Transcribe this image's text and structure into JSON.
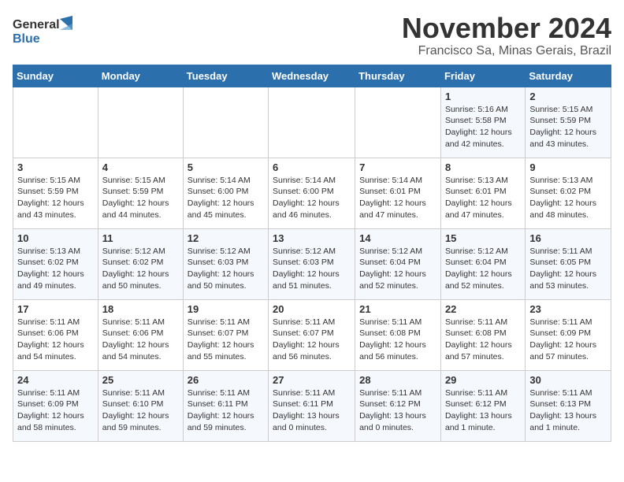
{
  "header": {
    "logo_line1": "General",
    "logo_line2": "Blue",
    "month": "November 2024",
    "location": "Francisco Sa, Minas Gerais, Brazil"
  },
  "weekdays": [
    "Sunday",
    "Monday",
    "Tuesday",
    "Wednesday",
    "Thursday",
    "Friday",
    "Saturday"
  ],
  "weeks": [
    [
      {
        "day": "",
        "info": ""
      },
      {
        "day": "",
        "info": ""
      },
      {
        "day": "",
        "info": ""
      },
      {
        "day": "",
        "info": ""
      },
      {
        "day": "",
        "info": ""
      },
      {
        "day": "1",
        "info": "Sunrise: 5:16 AM\nSunset: 5:58 PM\nDaylight: 12 hours and 42 minutes."
      },
      {
        "day": "2",
        "info": "Sunrise: 5:15 AM\nSunset: 5:59 PM\nDaylight: 12 hours and 43 minutes."
      }
    ],
    [
      {
        "day": "3",
        "info": "Sunrise: 5:15 AM\nSunset: 5:59 PM\nDaylight: 12 hours and 43 minutes."
      },
      {
        "day": "4",
        "info": "Sunrise: 5:15 AM\nSunset: 5:59 PM\nDaylight: 12 hours and 44 minutes."
      },
      {
        "day": "5",
        "info": "Sunrise: 5:14 AM\nSunset: 6:00 PM\nDaylight: 12 hours and 45 minutes."
      },
      {
        "day": "6",
        "info": "Sunrise: 5:14 AM\nSunset: 6:00 PM\nDaylight: 12 hours and 46 minutes."
      },
      {
        "day": "7",
        "info": "Sunrise: 5:14 AM\nSunset: 6:01 PM\nDaylight: 12 hours and 47 minutes."
      },
      {
        "day": "8",
        "info": "Sunrise: 5:13 AM\nSunset: 6:01 PM\nDaylight: 12 hours and 47 minutes."
      },
      {
        "day": "9",
        "info": "Sunrise: 5:13 AM\nSunset: 6:02 PM\nDaylight: 12 hours and 48 minutes."
      }
    ],
    [
      {
        "day": "10",
        "info": "Sunrise: 5:13 AM\nSunset: 6:02 PM\nDaylight: 12 hours and 49 minutes."
      },
      {
        "day": "11",
        "info": "Sunrise: 5:12 AM\nSunset: 6:02 PM\nDaylight: 12 hours and 50 minutes."
      },
      {
        "day": "12",
        "info": "Sunrise: 5:12 AM\nSunset: 6:03 PM\nDaylight: 12 hours and 50 minutes."
      },
      {
        "day": "13",
        "info": "Sunrise: 5:12 AM\nSunset: 6:03 PM\nDaylight: 12 hours and 51 minutes."
      },
      {
        "day": "14",
        "info": "Sunrise: 5:12 AM\nSunset: 6:04 PM\nDaylight: 12 hours and 52 minutes."
      },
      {
        "day": "15",
        "info": "Sunrise: 5:12 AM\nSunset: 6:04 PM\nDaylight: 12 hours and 52 minutes."
      },
      {
        "day": "16",
        "info": "Sunrise: 5:11 AM\nSunset: 6:05 PM\nDaylight: 12 hours and 53 minutes."
      }
    ],
    [
      {
        "day": "17",
        "info": "Sunrise: 5:11 AM\nSunset: 6:06 PM\nDaylight: 12 hours and 54 minutes."
      },
      {
        "day": "18",
        "info": "Sunrise: 5:11 AM\nSunset: 6:06 PM\nDaylight: 12 hours and 54 minutes."
      },
      {
        "day": "19",
        "info": "Sunrise: 5:11 AM\nSunset: 6:07 PM\nDaylight: 12 hours and 55 minutes."
      },
      {
        "day": "20",
        "info": "Sunrise: 5:11 AM\nSunset: 6:07 PM\nDaylight: 12 hours and 56 minutes."
      },
      {
        "day": "21",
        "info": "Sunrise: 5:11 AM\nSunset: 6:08 PM\nDaylight: 12 hours and 56 minutes."
      },
      {
        "day": "22",
        "info": "Sunrise: 5:11 AM\nSunset: 6:08 PM\nDaylight: 12 hours and 57 minutes."
      },
      {
        "day": "23",
        "info": "Sunrise: 5:11 AM\nSunset: 6:09 PM\nDaylight: 12 hours and 57 minutes."
      }
    ],
    [
      {
        "day": "24",
        "info": "Sunrise: 5:11 AM\nSunset: 6:09 PM\nDaylight: 12 hours and 58 minutes."
      },
      {
        "day": "25",
        "info": "Sunrise: 5:11 AM\nSunset: 6:10 PM\nDaylight: 12 hours and 59 minutes."
      },
      {
        "day": "26",
        "info": "Sunrise: 5:11 AM\nSunset: 6:11 PM\nDaylight: 12 hours and 59 minutes."
      },
      {
        "day": "27",
        "info": "Sunrise: 5:11 AM\nSunset: 6:11 PM\nDaylight: 13 hours and 0 minutes."
      },
      {
        "day": "28",
        "info": "Sunrise: 5:11 AM\nSunset: 6:12 PM\nDaylight: 13 hours and 0 minutes."
      },
      {
        "day": "29",
        "info": "Sunrise: 5:11 AM\nSunset: 6:12 PM\nDaylight: 13 hours and 1 minute."
      },
      {
        "day": "30",
        "info": "Sunrise: 5:11 AM\nSunset: 6:13 PM\nDaylight: 13 hours and 1 minute."
      }
    ]
  ]
}
